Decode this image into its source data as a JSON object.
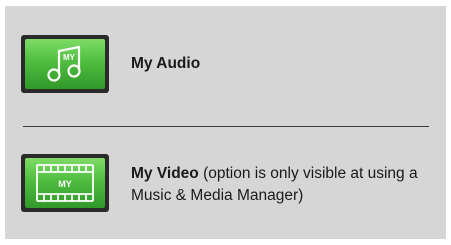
{
  "items": [
    {
      "title": "My Audio",
      "note": "",
      "icon": "music-note-icon",
      "icon_badge": "MY"
    },
    {
      "title": "My Video",
      "note": " (option is only visible at using a Music & Media Manager)",
      "icon": "film-strip-icon",
      "icon_badge": "MY"
    }
  ],
  "colors": {
    "panel": "#d6d6d6",
    "icon_green_top": "#7fdc67",
    "icon_green_bottom": "#31992a",
    "icon_frame": "#2a2a2a",
    "divider": "#3a3a3a"
  }
}
